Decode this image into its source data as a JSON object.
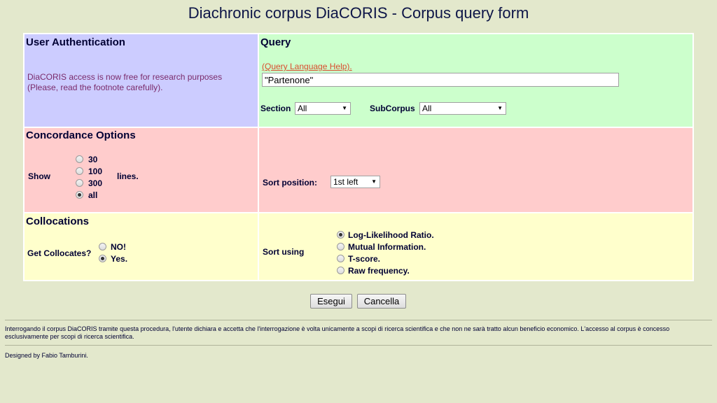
{
  "page": {
    "title": "Diachronic corpus DiaCORIS - Corpus query form"
  },
  "auth": {
    "heading": "User Authentication",
    "note_line1": "DiaCORIS access is now free for research purposes",
    "note_line2": "(Please, read the footnote carefully)."
  },
  "query": {
    "heading": "Query",
    "help_link": "(Query Language Help).",
    "value": "\"Partenone\"",
    "section_label": "Section",
    "section_value": "All",
    "subcorpus_label": "SubCorpus",
    "subcorpus_value": "All"
  },
  "concordance": {
    "heading": "Concordance Options",
    "show_label": "Show",
    "lines_label": "lines.",
    "options": [
      "30",
      "100",
      "300",
      "all"
    ],
    "selected": "all",
    "sort_position_label": "Sort position:",
    "sort_position_value": "1st left"
  },
  "collocations": {
    "heading": "Collocations",
    "get_label": "Get Collocates?",
    "options": [
      "NO!",
      "Yes."
    ],
    "selected": "Yes.",
    "sort_label": "Sort using",
    "sort_options": [
      "Log-Likelihood Ratio.",
      "Mutual Information.",
      "T-score.",
      "Raw frequency."
    ],
    "sort_selected": "Log-Likelihood Ratio."
  },
  "buttons": {
    "run": "Esegui",
    "cancel": "Cancella"
  },
  "footer": {
    "disclaimer": "Interrogando il corpus DiaCORIS tramite questa procedura, l'utente dichiara e accetta che l'interrogazione è volta unicamente a scopi di ricerca scientifica e che non ne sarà tratto alcun beneficio economico. L'accesso al corpus è concesso esclusivamente per scopi di ricerca scientifica.",
    "designed_by": "Designed by Fabio Tamburini."
  },
  "colors": {
    "background": "#e3e8cc",
    "auth_bg": "#ccccff",
    "query_bg": "#ccffcc",
    "concordance_bg": "#ffcccc",
    "collocations_bg": "#ffffcc",
    "link": "#d94c2e"
  }
}
